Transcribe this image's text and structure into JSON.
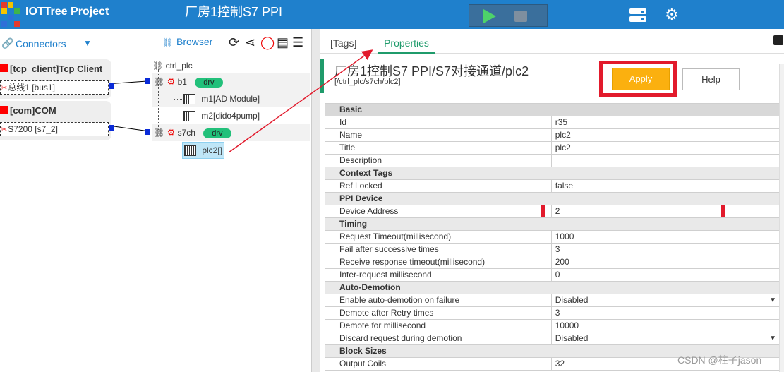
{
  "app": {
    "title": "IOTTree Project",
    "project_title": "厂房1控制S7 PPI"
  },
  "colors": {
    "topbar": "#1f80cc",
    "accent_green": "#1f9b6b",
    "apply": "#fbb00f",
    "badge": "#22c07a",
    "highlight_red": "#e21a2c"
  },
  "connectors": {
    "label": "Connectors",
    "items": [
      {
        "name": "[tcp_client]Tcp Client",
        "sub": "总线1 [bus1]"
      },
      {
        "name": "[com]COM",
        "sub": "S7200 [s7_2]"
      }
    ]
  },
  "browser": {
    "label": "Browser",
    "root": "ctrl_plc",
    "nodes": [
      {
        "label": "b1",
        "badge": "drv"
      },
      {
        "label": "m1[AD Module]"
      },
      {
        "label": "m2[dido4pump]"
      },
      {
        "label": "s7ch",
        "badge": "drv"
      },
      {
        "label": "plc2[]"
      }
    ]
  },
  "tabs": {
    "tags": "[Tags]",
    "properties": "Properties"
  },
  "device": {
    "title": "厂房1控制S7 PPI/S7对接通道/plc2",
    "path": "[/ctrl_plc/s7ch/plc2]"
  },
  "buttons": {
    "apply": "Apply",
    "help": "Help"
  },
  "groups": [
    {
      "name": "Basic",
      "rows": [
        [
          "Id",
          "r35"
        ],
        [
          "Name",
          "plc2"
        ],
        [
          "Title",
          "plc2"
        ],
        [
          "Description",
          ""
        ]
      ]
    },
    {
      "name": "Context Tags",
      "rows": [
        [
          "Ref Locked",
          "false"
        ]
      ]
    },
    {
      "name": "PPI Device",
      "rows": [
        [
          "Device Address",
          "2"
        ]
      ]
    },
    {
      "name": "Timing",
      "rows": [
        [
          "Request Timeout(millisecond)",
          "1000"
        ],
        [
          "Fail after successive times",
          "3"
        ],
        [
          "Receive response timeout(millisecond)",
          "200"
        ],
        [
          "Inter-request millisecond",
          "0"
        ]
      ]
    },
    {
      "name": "Auto-Demotion",
      "rows": [
        [
          "Enable auto-demotion on failure",
          "Disabled"
        ],
        [
          "Demote after Retry times",
          "3"
        ],
        [
          "Demote for millisecond",
          "10000"
        ],
        [
          "Discard request during demotion",
          "Disabled"
        ]
      ]
    },
    {
      "name": "Block Sizes",
      "rows": [
        [
          "Output Coils",
          "32"
        ]
      ]
    }
  ],
  "watermark": "CSDN @柱子jason"
}
